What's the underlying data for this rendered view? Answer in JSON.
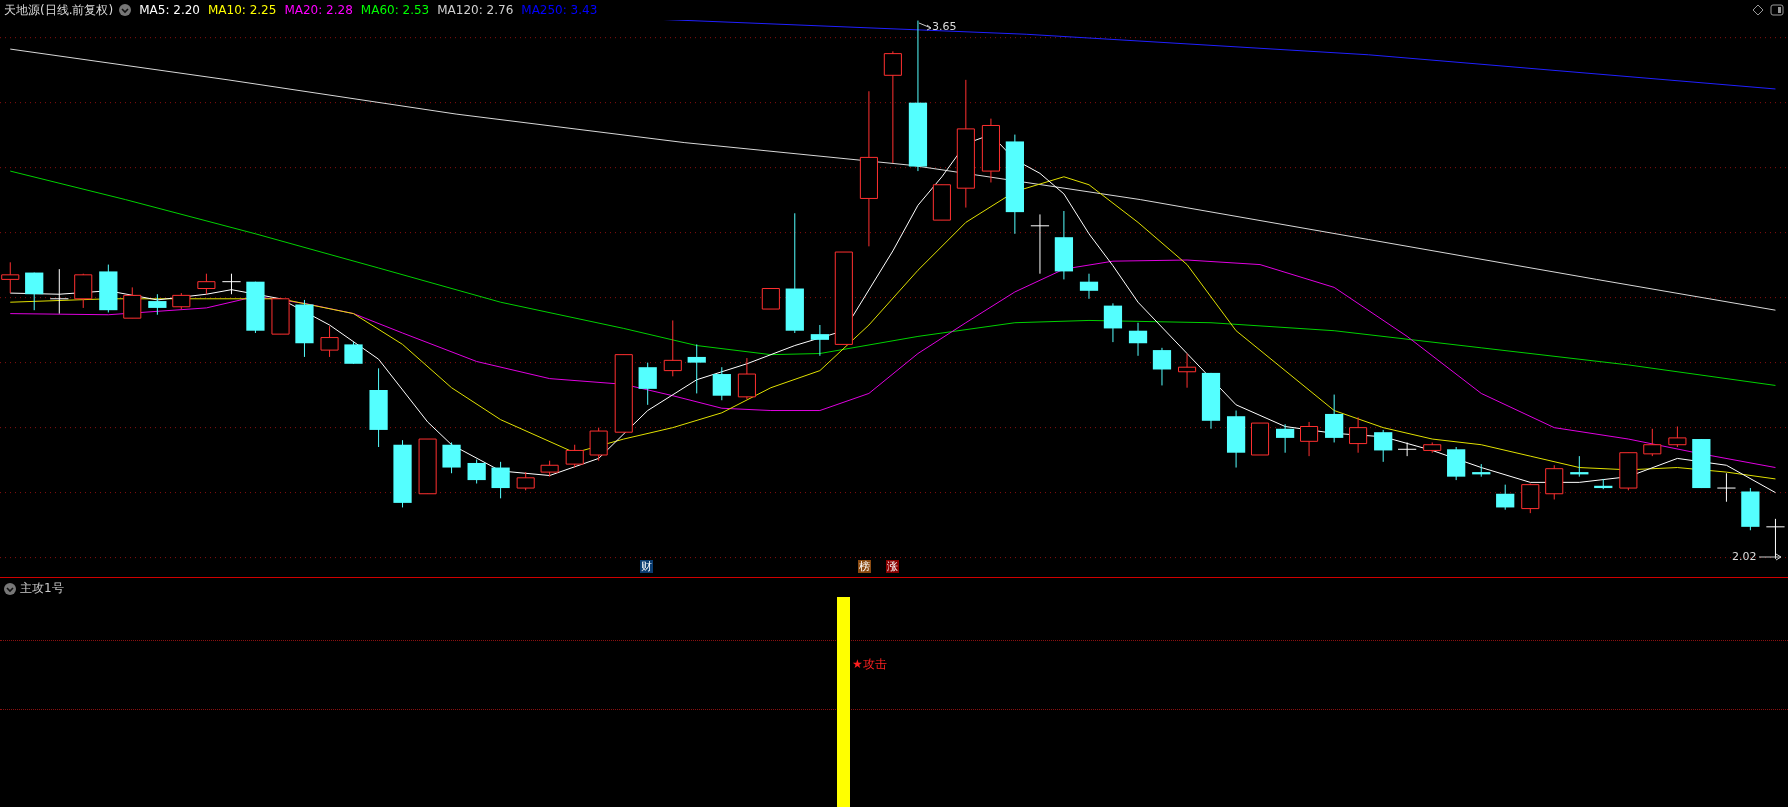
{
  "header": {
    "title": "天地源(日线.前复权)",
    "indicators": [
      {
        "label": "MA5: 2.20",
        "color": "#ffffff"
      },
      {
        "label": "MA10: 2.25",
        "color": "#ffff00"
      },
      {
        "label": "MA20: 2.28",
        "color": "#ff00ff"
      },
      {
        "label": "MA60: 2.53",
        "color": "#00ff00"
      },
      {
        "label": "MA120: 2.76",
        "color": "#d0d0d0"
      },
      {
        "label": "MA250: 3.43",
        "color": "#0000ff"
      }
    ]
  },
  "chart": {
    "high_label": "3.65",
    "low_label": "2.02",
    "markers": [
      {
        "text": "财",
        "color": "#0a3c70"
      },
      {
        "text": "榜",
        "color": "#8a4a10"
      },
      {
        "text": "涨",
        "color": "#8a0000"
      }
    ]
  },
  "lower_panel": {
    "title": "主攻1号",
    "signal_label": "★攻击"
  }
}
